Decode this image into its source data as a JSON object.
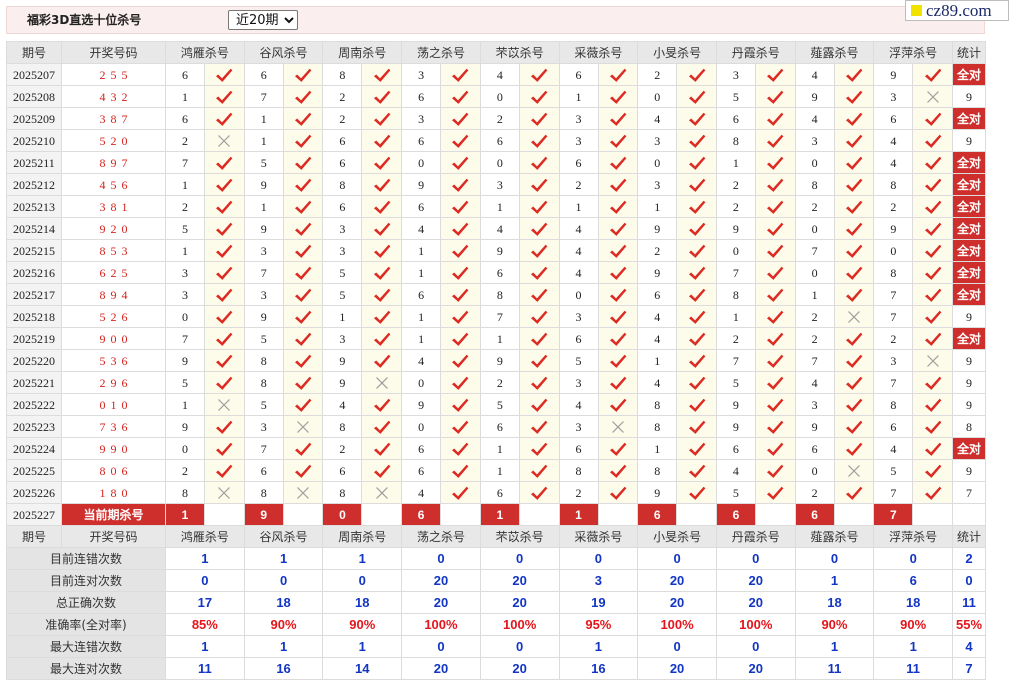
{
  "header": {
    "title": "福彩3D直选十位杀号",
    "period_select": {
      "selected": "近20期"
    }
  },
  "logo": {
    "text": "cz89.com"
  },
  "columns": {
    "issue": "期号",
    "draw": "开奖号码",
    "experts": [
      "鸿雁杀号",
      "谷风杀号",
      "周南杀号",
      "荡之杀号",
      "芣苡杀号",
      "采薇杀号",
      "小旻杀号",
      "丹霞杀号",
      "薤露杀号",
      "浮萍杀号"
    ],
    "stat": "统计"
  },
  "rows": [
    {
      "issue": "2025207",
      "draw": "255",
      "kills": [
        6,
        6,
        8,
        3,
        4,
        6,
        2,
        3,
        4,
        9
      ],
      "hits": [
        1,
        1,
        1,
        1,
        1,
        1,
        1,
        1,
        1,
        1
      ],
      "stat": "全对"
    },
    {
      "issue": "2025208",
      "draw": "432",
      "kills": [
        1,
        7,
        2,
        6,
        0,
        1,
        0,
        5,
        9,
        3
      ],
      "hits": [
        1,
        1,
        1,
        1,
        1,
        1,
        1,
        1,
        1,
        0
      ],
      "stat": "9"
    },
    {
      "issue": "2025209",
      "draw": "387",
      "kills": [
        6,
        1,
        2,
        3,
        2,
        3,
        4,
        6,
        4,
        6
      ],
      "hits": [
        1,
        1,
        1,
        1,
        1,
        1,
        1,
        1,
        1,
        1
      ],
      "stat": "全对"
    },
    {
      "issue": "2025210",
      "draw": "520",
      "kills": [
        2,
        1,
        6,
        6,
        6,
        3,
        3,
        8,
        3,
        4
      ],
      "hits": [
        0,
        1,
        1,
        1,
        1,
        1,
        1,
        1,
        1,
        1
      ],
      "stat": "9"
    },
    {
      "issue": "2025211",
      "draw": "897",
      "kills": [
        7,
        5,
        6,
        0,
        0,
        6,
        0,
        1,
        0,
        4
      ],
      "hits": [
        1,
        1,
        1,
        1,
        1,
        1,
        1,
        1,
        1,
        1
      ],
      "stat": "全对"
    },
    {
      "issue": "2025212",
      "draw": "456",
      "kills": [
        1,
        9,
        8,
        9,
        3,
        2,
        3,
        2,
        8,
        8
      ],
      "hits": [
        1,
        1,
        1,
        1,
        1,
        1,
        1,
        1,
        1,
        1
      ],
      "stat": "全对"
    },
    {
      "issue": "2025213",
      "draw": "381",
      "kills": [
        2,
        1,
        6,
        6,
        1,
        1,
        1,
        2,
        2,
        2
      ],
      "hits": [
        1,
        1,
        1,
        1,
        1,
        1,
        1,
        1,
        1,
        1
      ],
      "stat": "全对"
    },
    {
      "issue": "2025214",
      "draw": "920",
      "kills": [
        5,
        9,
        3,
        4,
        4,
        4,
        9,
        9,
        0,
        9
      ],
      "hits": [
        1,
        1,
        1,
        1,
        1,
        1,
        1,
        1,
        1,
        1
      ],
      "stat": "全对"
    },
    {
      "issue": "2025215",
      "draw": "853",
      "kills": [
        1,
        3,
        3,
        1,
        9,
        4,
        2,
        0,
        7,
        0
      ],
      "hits": [
        1,
        1,
        1,
        1,
        1,
        1,
        1,
        1,
        1,
        1
      ],
      "stat": "全对"
    },
    {
      "issue": "2025216",
      "draw": "625",
      "kills": [
        3,
        7,
        5,
        1,
        6,
        4,
        9,
        7,
        0,
        8
      ],
      "hits": [
        1,
        1,
        1,
        1,
        1,
        1,
        1,
        1,
        1,
        1
      ],
      "stat": "全对"
    },
    {
      "issue": "2025217",
      "draw": "894",
      "kills": [
        3,
        3,
        5,
        6,
        8,
        0,
        6,
        8,
        1,
        7
      ],
      "hits": [
        1,
        1,
        1,
        1,
        1,
        1,
        1,
        1,
        1,
        1
      ],
      "stat": "全对"
    },
    {
      "issue": "2025218",
      "draw": "526",
      "kills": [
        0,
        9,
        1,
        1,
        7,
        3,
        4,
        1,
        2,
        7
      ],
      "hits": [
        1,
        1,
        1,
        1,
        1,
        1,
        1,
        1,
        0,
        1
      ],
      "stat": "9"
    },
    {
      "issue": "2025219",
      "draw": "900",
      "kills": [
        7,
        5,
        3,
        1,
        1,
        6,
        4,
        2,
        2,
        2
      ],
      "hits": [
        1,
        1,
        1,
        1,
        1,
        1,
        1,
        1,
        1,
        1
      ],
      "stat": "全对"
    },
    {
      "issue": "2025220",
      "draw": "536",
      "kills": [
        9,
        8,
        9,
        4,
        9,
        5,
        1,
        7,
        7,
        3
      ],
      "hits": [
        1,
        1,
        1,
        1,
        1,
        1,
        1,
        1,
        1,
        0
      ],
      "stat": "9"
    },
    {
      "issue": "2025221",
      "draw": "296",
      "kills": [
        5,
        8,
        9,
        0,
        2,
        3,
        4,
        5,
        4,
        7
      ],
      "hits": [
        1,
        1,
        0,
        1,
        1,
        1,
        1,
        1,
        1,
        1
      ],
      "stat": "9"
    },
    {
      "issue": "2025222",
      "draw": "010",
      "kills": [
        1,
        5,
        4,
        9,
        5,
        4,
        8,
        9,
        3,
        8
      ],
      "hits": [
        0,
        1,
        1,
        1,
        1,
        1,
        1,
        1,
        1,
        1
      ],
      "stat": "9"
    },
    {
      "issue": "2025223",
      "draw": "736",
      "kills": [
        9,
        3,
        8,
        0,
        6,
        3,
        8,
        9,
        9,
        6
      ],
      "hits": [
        1,
        0,
        1,
        1,
        1,
        0,
        1,
        1,
        1,
        1
      ],
      "stat": "8"
    },
    {
      "issue": "2025224",
      "draw": "990",
      "kills": [
        0,
        7,
        2,
        6,
        1,
        6,
        1,
        6,
        6,
        4
      ],
      "hits": [
        1,
        1,
        1,
        1,
        1,
        1,
        1,
        1,
        1,
        1
      ],
      "stat": "全对"
    },
    {
      "issue": "2025225",
      "draw": "806",
      "kills": [
        2,
        6,
        6,
        6,
        1,
        8,
        8,
        4,
        0,
        5
      ],
      "hits": [
        1,
        1,
        1,
        1,
        1,
        1,
        1,
        1,
        0,
        1
      ],
      "stat": "9"
    },
    {
      "issue": "2025226",
      "draw": "180",
      "kills": [
        8,
        8,
        8,
        4,
        6,
        2,
        9,
        5,
        2,
        7
      ],
      "hits": [
        0,
        0,
        0,
        1,
        1,
        1,
        1,
        1,
        1,
        1
      ],
      "stat": "7"
    }
  ],
  "current": {
    "issue": "2025227",
    "label": "当前期杀号",
    "kills": [
      1,
      9,
      0,
      6,
      1,
      1,
      6,
      6,
      6,
      7
    ]
  },
  "stats": [
    {
      "label": "目前连错次数",
      "values": [
        "1",
        "1",
        "1",
        "0",
        "0",
        "0",
        "0",
        "0",
        "0",
        "0"
      ],
      "total": "2",
      "value_color": "#1235c4"
    },
    {
      "label": "目前连对次数",
      "values": [
        "0",
        "0",
        "0",
        "20",
        "20",
        "3",
        "20",
        "20",
        "1",
        "6"
      ],
      "total": "0",
      "value_color": "#1235c4"
    },
    {
      "label": "总正确次数",
      "values": [
        "17",
        "18",
        "18",
        "20",
        "20",
        "19",
        "20",
        "20",
        "18",
        "18"
      ],
      "total": "11",
      "value_color": "#1235c4"
    },
    {
      "label": "准确率(全对率)",
      "values": [
        "85%",
        "90%",
        "90%",
        "100%",
        "100%",
        "95%",
        "100%",
        "100%",
        "90%",
        "90%"
      ],
      "total": "55%",
      "value_color": "#e5151b"
    },
    {
      "label": "最大连错次数",
      "values": [
        "1",
        "1",
        "1",
        "0",
        "0",
        "1",
        "0",
        "0",
        "1",
        "1"
      ],
      "total": "4",
      "value_color": "#1235c4"
    },
    {
      "label": "最大连对次数",
      "values": [
        "11",
        "16",
        "14",
        "20",
        "20",
        "16",
        "20",
        "20",
        "11",
        "11"
      ],
      "total": "7",
      "value_color": "#1235c4"
    }
  ],
  "colors": {
    "check": "#dd2a22",
    "cross": "#9c9c9c",
    "highlight_red": "#cf2f2c",
    "logo_yellow": "#f2e200"
  }
}
